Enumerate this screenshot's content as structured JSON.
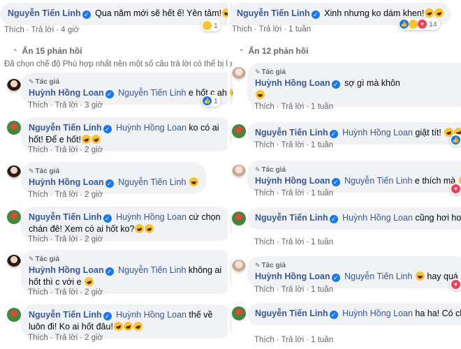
{
  "left": {
    "top_comment": {
      "author": "Nguyễn Tiến Linh",
      "text": "Qua năm mới sẽ hết ế! Yên tâm!",
      "like": "Thích",
      "reply": "Trả lời",
      "time": "4 giờ",
      "reaction_count": "1"
    },
    "hide_replies": "Ẩn 15 phản hồi",
    "notice": "Đã chọn chế độ Phù hợp nhất nên một số câu trả lời có thể bị lọ",
    "replies": [
      {
        "author_tag": "Tác giả",
        "author": "Huỳnh Hồng Loan",
        "mention": "Nguyễn Tiến Linh",
        "text": "e hốt c ah",
        "like": "Thích",
        "reply": "Trả lời",
        "time": "3 giờ",
        "reaction_count": "1"
      },
      {
        "author": "Nguyễn Tiến Linh",
        "mention": "Huỳnh Hồng Loan",
        "text": "ko có ai hốt! Để e hốt!",
        "like": "Thích",
        "reply": "Trả lời",
        "time": "2 giờ"
      },
      {
        "author_tag": "Tác giả",
        "author": "Huỳnh Hồng Loan",
        "mention": "Nguyễn Tiến Linh",
        "text": "",
        "like": "Thích",
        "reply": "Trả lời",
        "time": "2 giờ"
      },
      {
        "author": "Nguyễn Tiến Linh",
        "mention": "Huỳnh Hồng Loan",
        "text": "cứ chọn chán đê! Xem có ai hốt ko?",
        "like": "Thích",
        "reply": "Trả lời",
        "time": "2 giờ"
      },
      {
        "author_tag": "Tác giả",
        "author": "Huỳnh Hồng Loan",
        "mention": "Nguyễn Tiến Linh",
        "text": "không ai hốt thì c với e",
        "like": "Thích",
        "reply": "Trả lời",
        "time": "2 giờ"
      },
      {
        "author": "Nguyễn Tiến Linh",
        "mention": "Huỳnh Hồng Loan",
        "text": "thế về luôn đi! Ko ai hốt đâu!",
        "like": "Thích",
        "reply": "Trả lời",
        "time": "2 giờ"
      }
    ]
  },
  "right": {
    "top_comment": {
      "author": "Nguyễn Tiến Linh",
      "text": "Xinh nhưng ko dám khen!",
      "like": "Thích",
      "reply": "Trả lời",
      "time": "1 tuần",
      "reaction_count": "14"
    },
    "hide_replies": "Ẩn 12 phản hồi",
    "replies": [
      {
        "author_tag": "Tác giả",
        "author": "Huỳnh Hồng Loan",
        "mention": "",
        "text": "sợ gì mà khôn",
        "like": "Thích",
        "reply": "Trả lời",
        "time": "1 tuần"
      },
      {
        "author": "Nguyễn Tiến Linh",
        "mention": "Huỳnh Hồng Loan",
        "text": "giật tít!",
        "like": "Thích",
        "reply": "Trả lời",
        "time": "1 tuần"
      },
      {
        "author_tag": "Tác giả",
        "author": "Huỳnh Hồng Loan",
        "mention": "Nguyễn Tiến Linh",
        "text": "e thích mà",
        "like": "Thích",
        "reply": "Trả lời",
        "time": "1 tuần"
      },
      {
        "author": "Nguyễn Tiến Linh",
        "mention": "Huỳnh Hồng Loan",
        "text": "cũng hơi hơi! chuyện để nói!",
        "like": "Thích",
        "reply": "Trả lời",
        "time": "1 tuần"
      },
      {
        "author_tag": "Tác giả",
        "author": "Huỳnh Hồng Loan",
        "mention": "Nguyễn Tiến Linh",
        "text": "hay quá h",
        "like": "Thích",
        "reply": "Trả lời",
        "time": "1 tuần"
      },
      {
        "author": "Nguyễn Tiến Linh",
        "mention": "Huỳnh Hồng Loan",
        "text": "ha ha! Có chu để tám chứ!",
        "like": "Thích",
        "reply": "Trả lời",
        "time": "1 tuần"
      }
    ]
  }
}
